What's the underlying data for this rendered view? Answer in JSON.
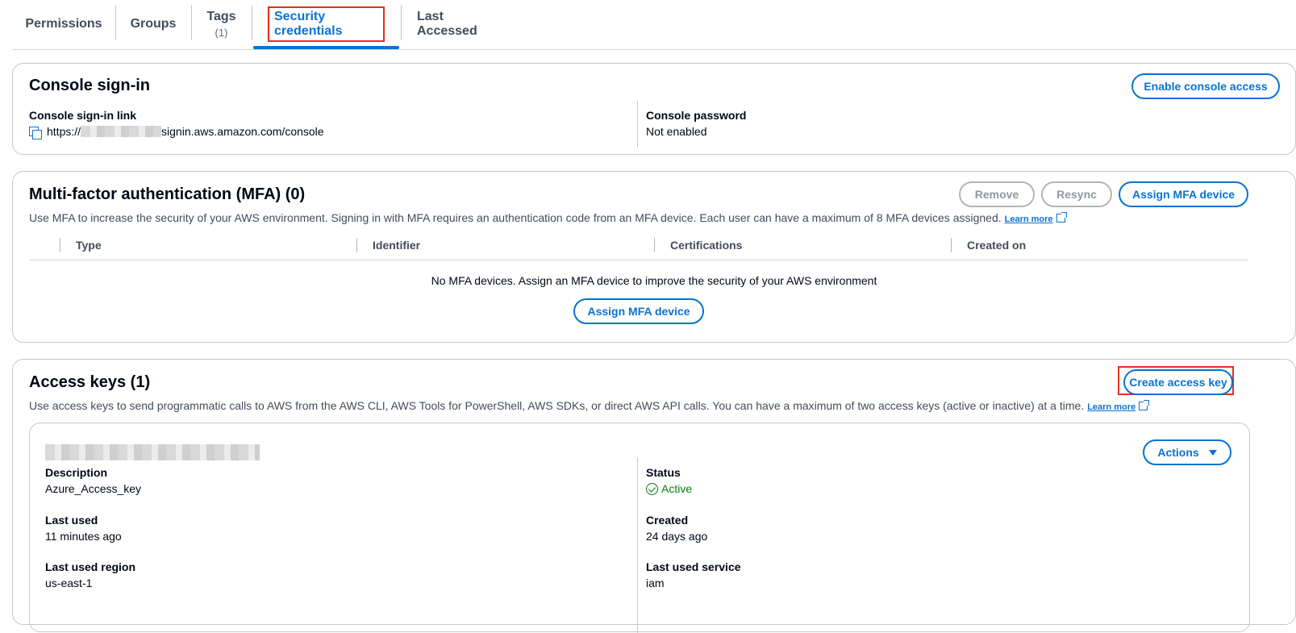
{
  "tabs": [
    {
      "label": "Permissions",
      "count": ""
    },
    {
      "label": "Groups",
      "count": ""
    },
    {
      "label": "Tags",
      "count": "(1)"
    },
    {
      "label": "Security credentials",
      "count": ""
    },
    {
      "label": "Last Accessed",
      "count": ""
    }
  ],
  "active_tab": "Security credentials",
  "console_signin": {
    "title": "Console sign-in",
    "enable_button": "Enable console access",
    "link_label": "Console sign-in link",
    "link_prefix": "https://",
    "link_suffix": "signin.aws.amazon.com/console",
    "password_label": "Console password",
    "password_value": "Not enabled"
  },
  "mfa": {
    "title": "Multi-factor authentication (MFA) (0)",
    "remove_button": "Remove",
    "resync_button": "Resync",
    "assign_button": "Assign MFA device",
    "description": "Use MFA to increase the security of your AWS environment. Signing in with MFA requires an authentication code from an MFA device. Each user can have a maximum of 8 MFA devices assigned.",
    "learn_more": "Learn more",
    "columns": [
      "Type",
      "Identifier",
      "Certifications",
      "Created on"
    ],
    "empty_text": "No MFA devices. Assign an MFA device to improve the security of your AWS environment",
    "empty_button": "Assign MFA device"
  },
  "access_keys": {
    "title": "Access keys (1)",
    "create_button": "Create access key",
    "description": "Use access keys to send programmatic calls to AWS from the AWS CLI, AWS Tools for PowerShell, AWS SDKs, or direct AWS API calls. You can have a maximum of two access keys (active or inactive) at a time.",
    "learn_more": "Learn more",
    "actions_button": "Actions",
    "key": {
      "description_label": "Description",
      "description_value": "Azure_Access_key",
      "last_used_label": "Last used",
      "last_used_value": "11 minutes ago",
      "last_used_region_label": "Last used region",
      "last_used_region_value": "us-east-1",
      "status_label": "Status",
      "status_value": "Active",
      "created_label": "Created",
      "created_value": "24 days ago",
      "last_used_service_label": "Last used service",
      "last_used_service_value": "iam"
    }
  },
  "colors": {
    "accent": "#0972d3",
    "highlight": "#e0301e",
    "success": "#037f0c"
  }
}
